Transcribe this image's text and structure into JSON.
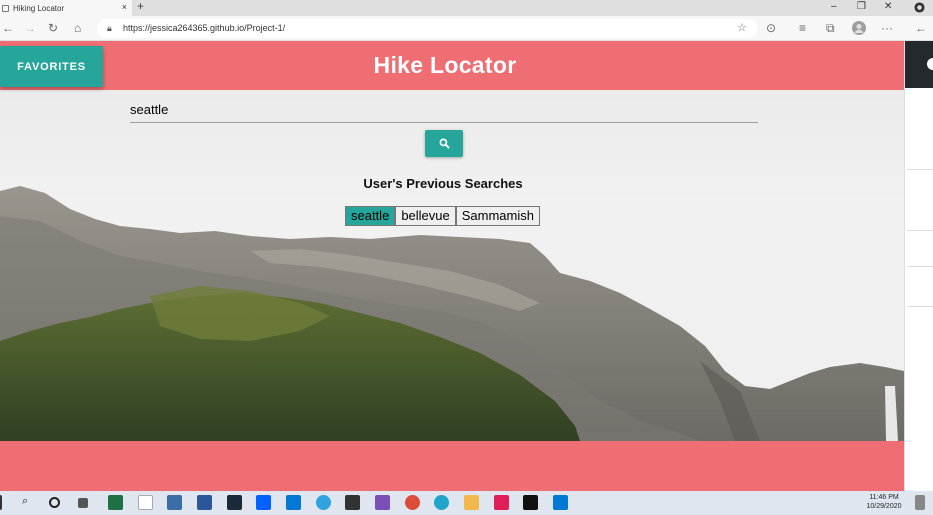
{
  "browser": {
    "tab_title": "Hiking Locator",
    "tab_close": "×",
    "new_tab": "+",
    "url": "https://jessica264365.github.io/Project-1/",
    "window_minimize": "–",
    "window_restore": "❐",
    "window_close": "✕"
  },
  "header": {
    "title": "Hike Locator",
    "favorites_label": "FAVORITES"
  },
  "search": {
    "value": "seattle"
  },
  "previous": {
    "title": "User's Previous Searches",
    "items": [
      "seattle",
      "bellevue",
      "Sammamish"
    ]
  },
  "taskbar": {
    "time": "11:46 PM",
    "date": "10/29/2020"
  },
  "colors": {
    "header": "#ee6e73",
    "accent": "#26a69a"
  }
}
